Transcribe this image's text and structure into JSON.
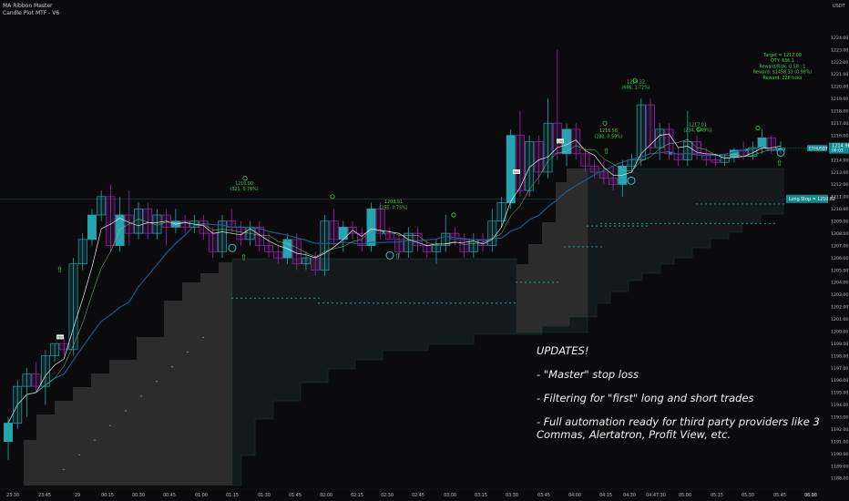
{
  "header": {
    "line1": "MA Ribbon Master",
    "line2": "Candle Plot MTF - V6"
  },
  "currency": "USDT",
  "price_labels": {
    "current": "1214.96",
    "countdown": "00:03",
    "ticker": "ETHUSDT",
    "long_stop": "Long Stop = 1210.82"
  },
  "notes": {
    "title": "UPDATES!",
    "items": [
      "- \"Master\" stop loss",
      "- Filtering for \"first\" long and short trades",
      "- Full automation ready for third party providers like 3 Commas, Alertatron, Profit View, etc."
    ]
  },
  "annotations": {
    "a1": [
      "1210.00",
      "(321, 0.76%)"
    ],
    "a2": [
      "1208.91",
      "(255, 0.75%)"
    ],
    "a3": [
      "1216.56",
      "(280, 0.59%)"
    ],
    "a4": [
      "1219.32",
      "(666, 1.72%)"
    ],
    "a5": [
      "1217.01",
      "(234, 0.49%)"
    ],
    "a6": [
      "Target = 1217.08",
      "QTY: 636.1",
      "Reward/Risk: 0.58 : 1",
      "Reward: $1458.31 (0.98%)",
      "Reward: 228 ticks"
    ]
  },
  "marks": {
    "up1": "700",
    "up2": "100",
    "up3": "500"
  },
  "colors": {
    "bull": "#26a5b0",
    "bear": "#9c27b0",
    "ma_blue": "#1e5f8e",
    "ma_white": "#e6e6e6",
    "ma_green": "#7ad17a",
    "signal": "#3ecf4d",
    "stop_dots": "#27c4c9",
    "shade_grey": "#2c2c2c",
    "shade_dark": "#141a1b"
  },
  "chart_data": {
    "type": "candlestick",
    "symbol": "ETHUSDT",
    "ylim": [
      1187.4,
      1225.2
    ],
    "y_ticks": [
      "1188.00",
      "1189.00",
      "1190.00",
      "1191.00",
      "1192.00",
      "1193.00",
      "1194.00",
      "1195.00",
      "1196.00",
      "1197.00",
      "1198.00",
      "1199.00",
      "1200.00",
      "1201.00",
      "1202.00",
      "1203.00",
      "1204.00",
      "1205.00",
      "1206.00",
      "1207.00",
      "1208.00",
      "1209.00",
      "1210.00",
      "1211.00",
      "1212.00",
      "1213.00",
      "1214.00",
      "1215.00",
      "1216.00",
      "1217.00",
      "1218.00",
      "1219.00",
      "1220.00",
      "1221.00",
      "1222.00",
      "1223.00",
      "1224.00"
    ],
    "x_ticks": [
      "23:30",
      "23:45",
      "29",
      "00:15",
      "00:30",
      "00:45",
      "01:00",
      "01:15",
      "01:30",
      "01:45",
      "02:00",
      "02:15",
      "02:30",
      "02:45",
      "03:00",
      "03:15",
      "03:30",
      "03:45",
      "04:00",
      "04:15",
      "04:30",
      "04:47:30",
      "05:00",
      "05:15",
      "05:30",
      "05:45",
      "06:00",
      "06:15"
    ],
    "candles": [
      [
        1191.0,
        1193.0,
        1189.5,
        1192.5
      ],
      [
        1192.5,
        1196.0,
        1192.0,
        1195.5
      ],
      [
        1195.5,
        1197.0,
        1193.0,
        1196.5
      ],
      [
        1196.5,
        1197.5,
        1195.0,
        1195.5
      ],
      [
        1195.5,
        1198.5,
        1194.0,
        1198.0
      ],
      [
        1198.0,
        1199.0,
        1197.5,
        1199.0
      ],
      [
        1199.0,
        1199.5,
        1198.0,
        1198.5
      ],
      [
        1198.5,
        1206.0,
        1198.0,
        1205.5
      ],
      [
        1205.5,
        1208.0,
        1205.0,
        1207.5
      ],
      [
        1207.5,
        1210.0,
        1207.0,
        1209.5
      ],
      [
        1209.5,
        1211.5,
        1209.0,
        1211.0
      ],
      [
        1211.0,
        1212.0,
        1206.5,
        1207.0
      ],
      [
        1207.0,
        1211.0,
        1206.5,
        1209.5
      ],
      [
        1209.5,
        1211.5,
        1207.0,
        1208.0
      ],
      [
        1208.0,
        1210.5,
        1207.5,
        1210.0
      ],
      [
        1210.0,
        1210.5,
        1207.5,
        1208.0
      ],
      [
        1208.0,
        1210.0,
        1207.5,
        1209.5
      ],
      [
        1209.5,
        1210.0,
        1207.0,
        1208.5
      ],
      [
        1208.5,
        1210.0,
        1208.0,
        1209.0
      ],
      [
        1209.0,
        1209.5,
        1208.0,
        1208.5
      ],
      [
        1208.5,
        1209.5,
        1208.0,
        1209.0
      ],
      [
        1209.0,
        1209.5,
        1207.5,
        1208.0
      ],
      [
        1208.0,
        1208.5,
        1206.0,
        1206.5
      ],
      [
        1206.5,
        1209.5,
        1206.0,
        1209.0
      ],
      [
        1209.0,
        1210.0,
        1208.0,
        1208.5
      ],
      [
        1208.5,
        1209.0,
        1207.0,
        1207.5
      ],
      [
        1207.5,
        1209.0,
        1207.0,
        1208.5
      ],
      [
        1208.5,
        1209.0,
        1206.5,
        1207.0
      ],
      [
        1207.0,
        1208.0,
        1206.0,
        1206.5
      ],
      [
        1206.5,
        1207.0,
        1205.5,
        1206.0
      ],
      [
        1206.0,
        1208.0,
        1205.5,
        1207.5
      ],
      [
        1207.5,
        1208.0,
        1205.0,
        1205.5
      ],
      [
        1205.5,
        1206.5,
        1205.0,
        1206.0
      ],
      [
        1206.0,
        1206.5,
        1204.5,
        1205.0
      ],
      [
        1205.0,
        1209.5,
        1204.5,
        1209.0
      ],
      [
        1209.0,
        1210.0,
        1207.0,
        1207.5
      ],
      [
        1207.5,
        1209.0,
        1206.5,
        1208.5
      ],
      [
        1208.5,
        1209.0,
        1207.5,
        1208.0
      ],
      [
        1208.0,
        1208.5,
        1206.5,
        1207.0
      ],
      [
        1207.0,
        1210.5,
        1206.5,
        1210.0
      ],
      [
        1210.0,
        1210.5,
        1207.5,
        1208.0
      ],
      [
        1208.0,
        1208.5,
        1207.5,
        1207.5
      ],
      [
        1207.5,
        1208.0,
        1206.0,
        1206.5
      ],
      [
        1206.5,
        1208.5,
        1206.0,
        1208.0
      ],
      [
        1208.0,
        1208.5,
        1206.5,
        1207.0
      ],
      [
        1207.0,
        1207.5,
        1206.0,
        1206.5
      ],
      [
        1206.5,
        1207.5,
        1205.5,
        1207.0
      ],
      [
        1207.0,
        1209.5,
        1206.5,
        1208.0
      ],
      [
        1208.0,
        1208.5,
        1207.0,
        1207.5
      ],
      [
        1207.5,
        1208.0,
        1206.0,
        1206.5
      ],
      [
        1206.5,
        1208.0,
        1206.0,
        1207.5
      ],
      [
        1207.5,
        1208.0,
        1206.5,
        1207.0
      ],
      [
        1207.0,
        1210.0,
        1206.5,
        1209.0
      ],
      [
        1209.0,
        1211.0,
        1208.5,
        1210.5
      ],
      [
        1210.5,
        1216.5,
        1210.0,
        1216.0
      ],
      [
        1216.0,
        1218.0,
        1211.0,
        1211.5
      ],
      [
        1211.5,
        1216.0,
        1211.0,
        1215.5
      ],
      [
        1215.5,
        1216.0,
        1212.0,
        1213.0
      ],
      [
        1213.0,
        1219.0,
        1212.5,
        1217.0
      ],
      [
        1217.0,
        1223.0,
        1214.0,
        1214.5
      ],
      [
        1214.5,
        1217.0,
        1213.5,
        1216.5
      ],
      [
        1216.5,
        1217.0,
        1214.0,
        1214.5
      ],
      [
        1214.5,
        1215.0,
        1213.0,
        1213.5
      ],
      [
        1213.5,
        1214.0,
        1212.5,
        1213.0
      ],
      [
        1213.0,
        1214.0,
        1212.0,
        1212.5
      ],
      [
        1212.5,
        1213.5,
        1211.5,
        1212.0
      ],
      [
        1212.0,
        1214.0,
        1211.0,
        1213.5
      ],
      [
        1213.5,
        1214.5,
        1213.0,
        1214.0
      ],
      [
        1214.0,
        1219.0,
        1213.5,
        1218.5
      ],
      [
        1218.5,
        1219.0,
        1214.5,
        1215.0
      ],
      [
        1215.0,
        1217.0,
        1214.0,
        1216.5
      ],
      [
        1216.5,
        1217.0,
        1214.0,
        1214.5
      ],
      [
        1214.5,
        1215.0,
        1213.5,
        1214.0
      ],
      [
        1214.0,
        1218.0,
        1213.5,
        1215.5
      ],
      [
        1215.5,
        1216.0,
        1214.0,
        1214.5
      ],
      [
        1214.5,
        1215.0,
        1213.5,
        1214.0
      ],
      [
        1214.0,
        1214.5,
        1213.5,
        1213.8
      ],
      [
        1213.8,
        1214.5,
        1213.5,
        1214.2
      ],
      [
        1214.2,
        1215.0,
        1213.8,
        1214.8
      ],
      [
        1214.8,
        1215.5,
        1214.0,
        1214.3
      ],
      [
        1214.3,
        1215.5,
        1214.0,
        1215.0
      ],
      [
        1215.0,
        1216.5,
        1214.5,
        1215.8
      ],
      [
        1215.8,
        1216.0,
        1214.5,
        1214.8
      ],
      [
        1214.8,
        1215.5,
        1214.5,
        1214.96
      ]
    ]
  }
}
